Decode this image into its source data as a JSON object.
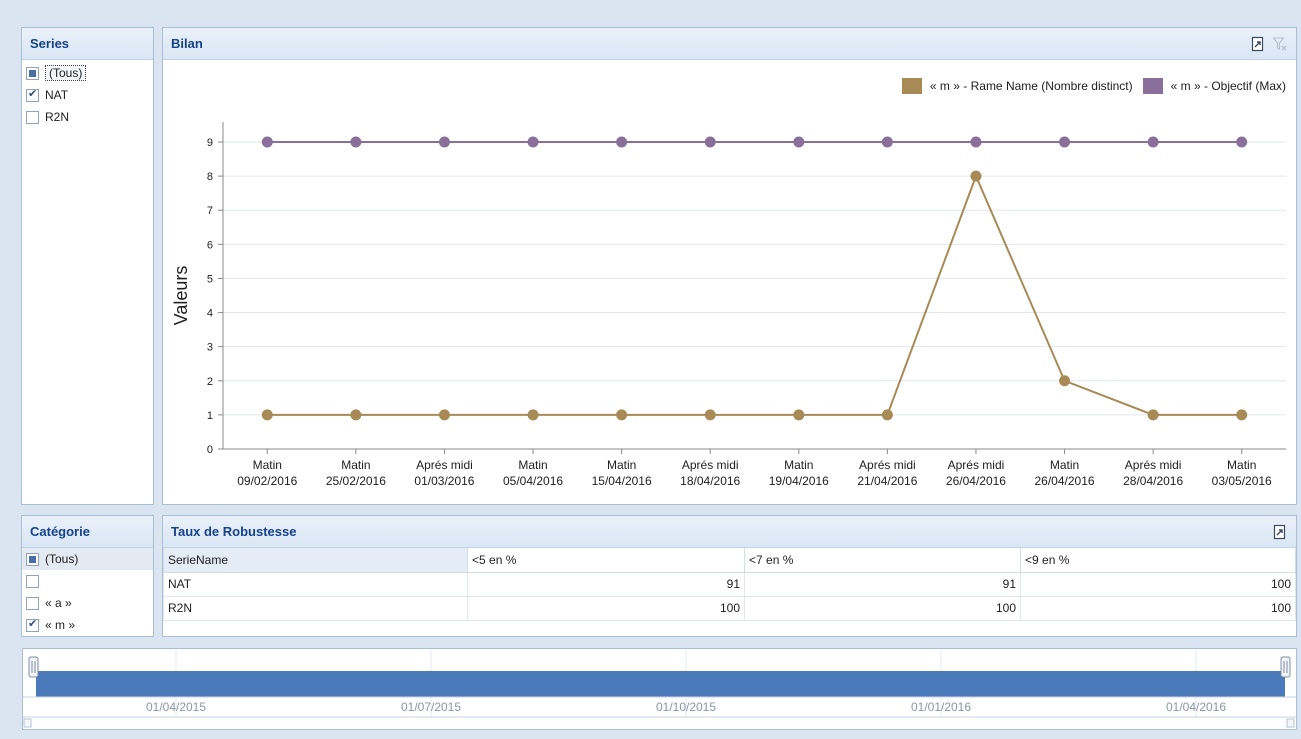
{
  "series_panel": {
    "title": "Series",
    "items": [
      {
        "label": "(Tous)",
        "state": "indeterminate"
      },
      {
        "label": "NAT",
        "state": "checked"
      },
      {
        "label": "R2N",
        "state": "unchecked"
      }
    ]
  },
  "categorie_panel": {
    "title": "Catégorie",
    "items": [
      {
        "label": "(Tous)",
        "state": "indeterminate"
      },
      {
        "label": "",
        "state": "unchecked"
      },
      {
        "label": "« a »",
        "state": "unchecked"
      },
      {
        "label": "« m »",
        "state": "checked"
      }
    ]
  },
  "bilan": {
    "title": "Bilan",
    "icons": [
      "export-icon",
      "clear-filter-icon"
    ]
  },
  "colors": {
    "series1": "#a88a57",
    "series2": "#8a6f9a"
  },
  "chart_data": {
    "type": "line",
    "ylabel": "Valeurs",
    "ylim": [
      0,
      9
    ],
    "yticks": [
      "0",
      "1",
      "2",
      "3",
      "4",
      "5",
      "6",
      "7",
      "8",
      "9"
    ],
    "grid": true,
    "legend_position": "top-right",
    "categories": [
      [
        "Matin",
        "09/02/2016"
      ],
      [
        "Matin",
        "25/02/2016"
      ],
      [
        "Aprés midi",
        "01/03/2016"
      ],
      [
        "Matin",
        "05/04/2016"
      ],
      [
        "Matin",
        "15/04/2016"
      ],
      [
        "Aprés midi",
        "18/04/2016"
      ],
      [
        "Matin",
        "19/04/2016"
      ],
      [
        "Aprés midi",
        "21/04/2016"
      ],
      [
        "Aprés midi",
        "26/04/2016"
      ],
      [
        "Matin",
        "26/04/2016"
      ],
      [
        "Aprés midi",
        "28/04/2016"
      ],
      [
        "Matin",
        "03/05/2016"
      ]
    ],
    "series": [
      {
        "name": "« m » - Rame Name (Nombre distinct)",
        "values": [
          1,
          1,
          1,
          1,
          1,
          1,
          1,
          1,
          8,
          2,
          1,
          1
        ]
      },
      {
        "name": "« m » - Objectif (Max)",
        "values": [
          9,
          9,
          9,
          9,
          9,
          9,
          9,
          9,
          9,
          9,
          9,
          9
        ]
      }
    ]
  },
  "robustesse": {
    "title": "Taux de Robustesse",
    "columns": [
      "SerieName",
      "<5 en %",
      "<7 en %",
      "<9 en %"
    ],
    "rows": [
      [
        "NAT",
        "91",
        "91",
        "100"
      ],
      [
        "R2N",
        "100",
        "100",
        "100"
      ]
    ]
  },
  "timeline": {
    "labels": [
      "01/04/2015",
      "01/07/2015",
      "01/10/2015",
      "01/01/2016",
      "01/04/2016"
    ]
  }
}
